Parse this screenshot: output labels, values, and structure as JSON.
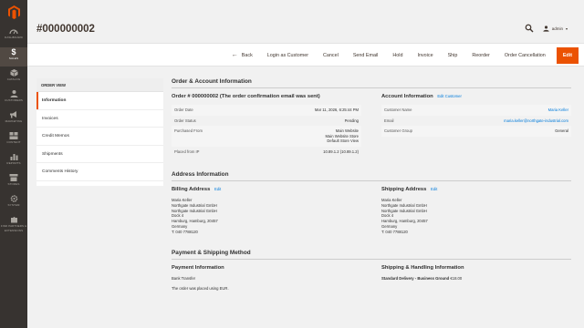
{
  "menu": [
    {
      "label": "Dashboard",
      "icon": "dashboard-icon",
      "active": false
    },
    {
      "label": "Sales",
      "icon": "dollar-icon",
      "active": true
    },
    {
      "label": "Catalog",
      "icon": "cube-icon",
      "active": false
    },
    {
      "label": "Customers",
      "icon": "person-icon",
      "active": false
    },
    {
      "label": "Marketing",
      "icon": "megaphone-icon",
      "active": false
    },
    {
      "label": "Content",
      "icon": "content-icon",
      "active": false
    },
    {
      "label": "Reports",
      "icon": "bar-chart-icon",
      "active": false
    },
    {
      "label": "Stores",
      "icon": "store-icon",
      "active": false
    },
    {
      "label": "System",
      "icon": "gear-icon",
      "active": false
    },
    {
      "label": "Find Partners & Extensions",
      "icon": "puzzle-icon",
      "active": false
    }
  ],
  "page": {
    "title": "#000000002",
    "user": "admin"
  },
  "actions": {
    "back": "Back",
    "login_as_customer": "Login as Customer",
    "cancel": "Cancel",
    "send_email": "Send Email",
    "hold": "Hold",
    "invoice": "Invoice",
    "ship": "Ship",
    "reorder": "Reorder",
    "order_cancellation": "Order Cancellation",
    "edit": "Edit"
  },
  "tabs": {
    "heading": "ORDER VIEW",
    "items": [
      "Information",
      "Invoices",
      "Credit Memos",
      "Shipments",
      "Comments History"
    ]
  },
  "order_account": {
    "title": "Order & Account Information",
    "order_heading": "Order # 000000002 (The order confirmation email was sent)",
    "order_rows": [
      {
        "label": "Order Date",
        "value": "Mar 11, 2026, 6:25:44 PM"
      },
      {
        "label": "Order Status",
        "value": "Pending"
      },
      {
        "label": "Purchased From",
        "value": "Main Website\nMain Website Store\nDefault Store View"
      },
      {
        "label": "Placed from IP",
        "value": "10.89.1.2 (10.89.1.2)"
      }
    ],
    "account_heading": "Account Information",
    "account_edit": "Edit Customer",
    "account_rows": [
      {
        "label": "Customer Name",
        "value": "Maria Keller"
      },
      {
        "label": "Email",
        "value": "maria.keller@northgate-industrial.com"
      },
      {
        "label": "Customer Group",
        "value": "General"
      }
    ]
  },
  "address": {
    "title": "Address Information",
    "billing_heading": "Billing Address",
    "billing_edit": "Edit",
    "billing_lines": [
      "Maria Keller",
      "Northgate Industrial GmbH",
      "Northgate Industrial GmbH",
      "Dock 4",
      "Hamburg, Hamburg, 20457",
      "Germany",
      "T: 040 7788120"
    ],
    "shipping_heading": "Shipping Address",
    "shipping_edit": "Edit",
    "shipping_lines": [
      "Maria Keller",
      "Northgate Industrial GmbH",
      "Northgate Industrial GmbH",
      "Dock 4",
      "Hamburg, Hamburg, 20457",
      "Germany",
      "T: 040 7788120"
    ]
  },
  "payment": {
    "title": "Payment & Shipping Method",
    "payment_heading": "Payment Information",
    "payment_method": "Bank Transfer",
    "payment_note": "The order was placed using EUR.",
    "shipping_heading": "Shipping & Handling Information",
    "shipping_method": "Standard Delivery - Business Ground",
    "shipping_price": "€18.00"
  },
  "colors": {
    "menu_bg": "#373330",
    "accent": "#eb5202",
    "link": "#007bdb"
  }
}
